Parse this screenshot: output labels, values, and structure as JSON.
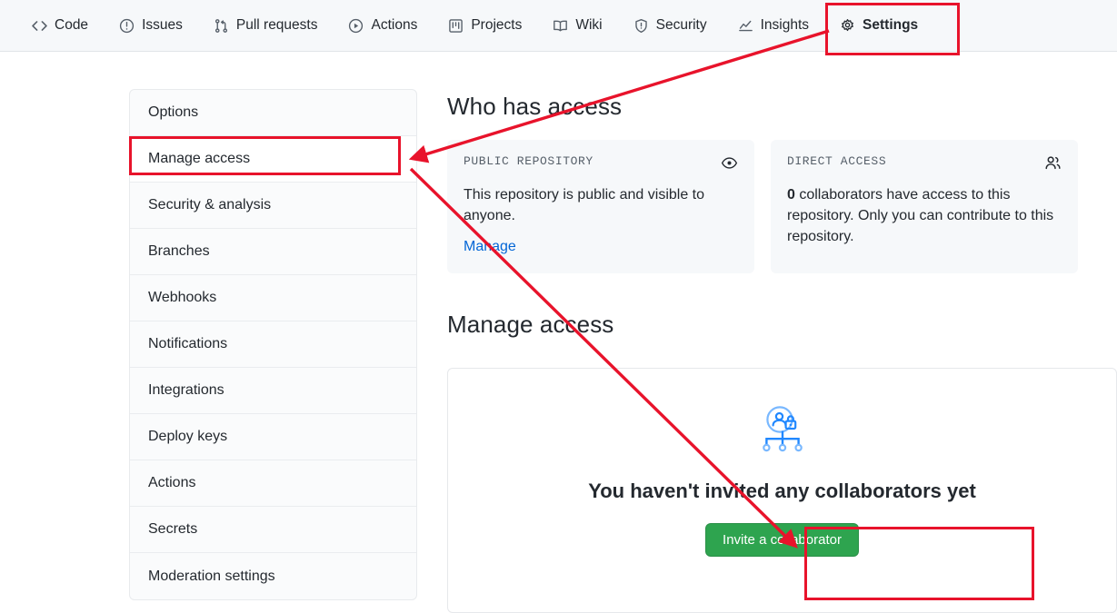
{
  "repo_nav": {
    "items": [
      {
        "label": "Code",
        "icon": "code-icon",
        "selected": false
      },
      {
        "label": "Issues",
        "icon": "issue-opened-icon",
        "selected": false
      },
      {
        "label": "Pull requests",
        "icon": "git-pull-request-icon",
        "selected": false
      },
      {
        "label": "Actions",
        "icon": "play-icon",
        "selected": false
      },
      {
        "label": "Projects",
        "icon": "project-icon",
        "selected": false
      },
      {
        "label": "Wiki",
        "icon": "book-icon",
        "selected": false
      },
      {
        "label": "Security",
        "icon": "shield-icon",
        "selected": false
      },
      {
        "label": "Insights",
        "icon": "graph-icon",
        "selected": false
      },
      {
        "label": "Settings",
        "icon": "gear-icon",
        "selected": true
      }
    ]
  },
  "sidebar": {
    "items": [
      {
        "label": "Options",
        "active": false
      },
      {
        "label": "Manage access",
        "active": true
      },
      {
        "label": "Security & analysis",
        "active": false
      },
      {
        "label": "Branches",
        "active": false
      },
      {
        "label": "Webhooks",
        "active": false
      },
      {
        "label": "Notifications",
        "active": false
      },
      {
        "label": "Integrations",
        "active": false
      },
      {
        "label": "Deploy keys",
        "active": false
      },
      {
        "label": "Actions",
        "active": false
      },
      {
        "label": "Secrets",
        "active": false
      },
      {
        "label": "Moderation settings",
        "active": false
      }
    ]
  },
  "who_has_access": {
    "heading": "Who has access",
    "cards": [
      {
        "label": "PUBLIC REPOSITORY",
        "icon": "eye-icon",
        "text": "This repository is public and visible to anyone.",
        "link": "Manage"
      },
      {
        "label": "DIRECT ACCESS",
        "icon": "people-icon",
        "count": "0",
        "text": " collaborators have access to this repository. Only you can contribute to this repository.",
        "link": ""
      }
    ]
  },
  "manage_access": {
    "heading": "Manage access",
    "empty_state": {
      "illustration": "collaborators-lock-icon",
      "title": "You haven't invited any collaborators yet",
      "button": "Invite a collaborator"
    }
  },
  "annotations": {
    "color": "#e8132b",
    "boxes": [
      "settings-tab",
      "manage-access-sidebar-item",
      "invite-collaborator-button"
    ],
    "arrows": [
      {
        "from": "settings-tab",
        "to": "manage-access-sidebar-item"
      },
      {
        "from": "manage-access-sidebar-item",
        "to": "invite-collaborator-button"
      }
    ]
  },
  "colors": {
    "accent_green": "#2ea44f",
    "link_blue": "#0366d6",
    "annotation_red": "#e8132b",
    "nav_bg": "#f6f8fa"
  }
}
